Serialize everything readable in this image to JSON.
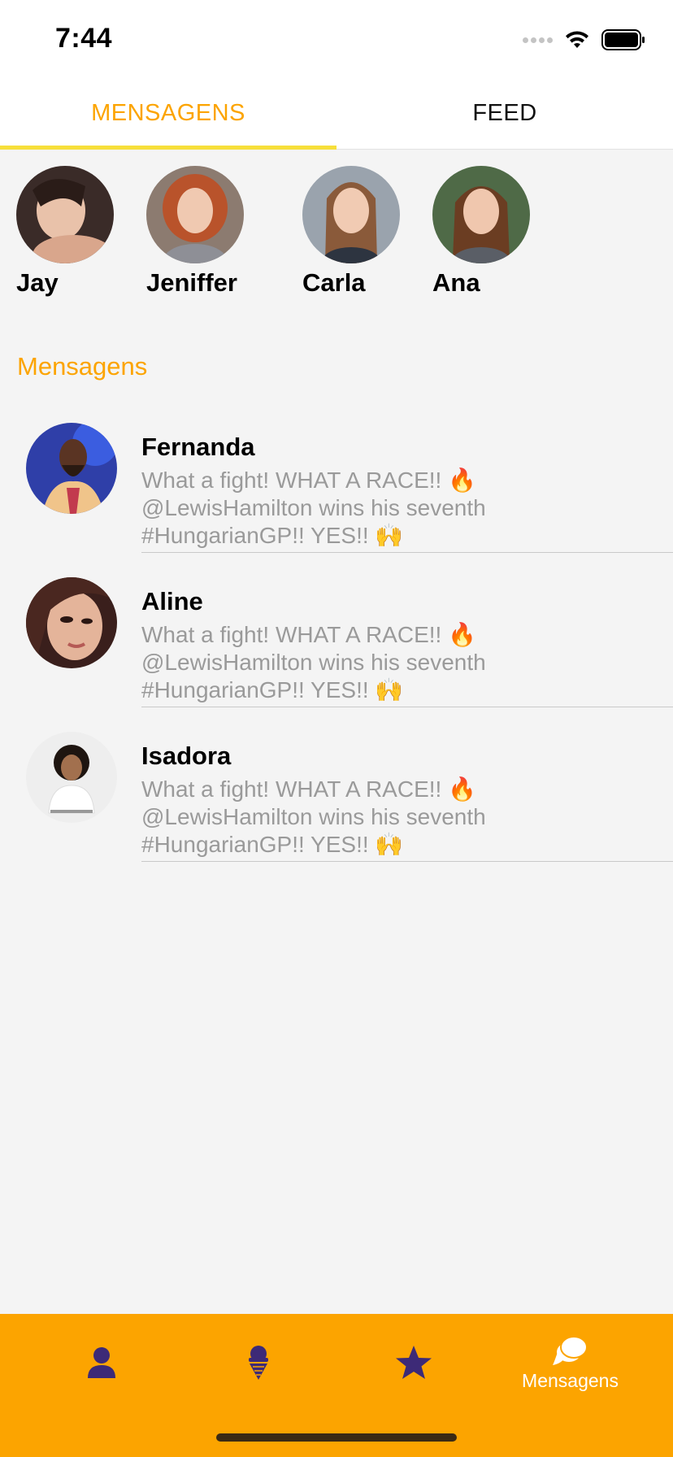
{
  "status_bar": {
    "time": "7:44"
  },
  "tabs": [
    {
      "label": "MENSAGENS",
      "active": true
    },
    {
      "label": "FEED",
      "active": false
    }
  ],
  "stories": [
    {
      "name": "Jay",
      "avatar": "avatar-jay"
    },
    {
      "name": "Jeniffer",
      "avatar": "avatar-jeniffer"
    },
    {
      "name": "Carla",
      "avatar": "avatar-carla"
    },
    {
      "name": "Ana",
      "avatar": "avatar-ana"
    }
  ],
  "section_title": "Mensagens",
  "messages": [
    {
      "name": "Fernanda",
      "text": "What a fight! WHAT A RACE!! 🔥 @LewisHamilton wins his seventh #HungarianGP!! YES!! 🙌"
    },
    {
      "name": "Aline",
      "text": "What a fight! WHAT A RACE!! 🔥 @LewisHamilton wins his seventh #HungarianGP!! YES!! 🙌"
    },
    {
      "name": "Isadora",
      "text": "What a fight! WHAT A RACE!! 🔥 @LewisHamilton wins his seventh #HungarianGP!! YES!! 🙌"
    }
  ],
  "bottom_nav": {
    "items": [
      {
        "icon": "person-icon",
        "label": ""
      },
      {
        "icon": "ice-cream-icon",
        "label": ""
      },
      {
        "icon": "star-icon",
        "label": ""
      },
      {
        "icon": "chat-bubbles-icon",
        "label": "Mensagens",
        "active": true
      }
    ]
  },
  "colors": {
    "accent": "#fca400",
    "tab_underline": "#f7df3a",
    "icon_purple": "#3d2a77",
    "background": "#f4f4f4"
  }
}
